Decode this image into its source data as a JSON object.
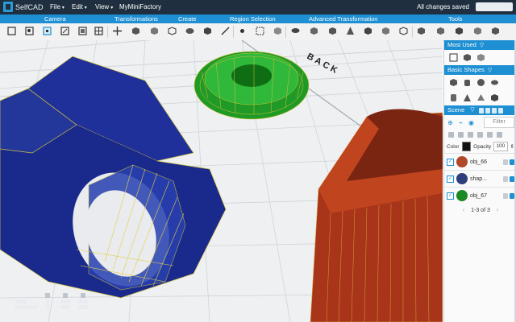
{
  "app": {
    "name": "SelfCAD",
    "project_title": "MyMiniFactory",
    "status": "All changes saved"
  },
  "menus": [
    {
      "label": "File"
    },
    {
      "label": "Edit"
    },
    {
      "label": "View"
    }
  ],
  "categories": [
    "Camera",
    "Transformations",
    "Create",
    "Region Selection",
    "Advanced Transformation",
    "Tools"
  ],
  "viewport": {
    "back_label": "BACK"
  },
  "stats": {
    "total_label": "Total",
    "selected_label": "Selected",
    "total": [
      "2",
      "493",
      "400"
    ],
    "selected": [
      "3",
      "493",
      "400"
    ]
  },
  "panel": {
    "most_used": "Most Used",
    "basic_shapes": "Basic Shapes",
    "scene": "Scene",
    "filter_placeholder": "Filter",
    "color_label": "Color",
    "opacity_label": "Opacity",
    "opacity_value": "100",
    "objects": [
      {
        "name": "obj_66",
        "thumb_color": "#b0492c"
      },
      {
        "name": "shap...",
        "thumb_color": "#2f3f7c"
      },
      {
        "name": "obj_67",
        "thumb_color": "#1a8a22"
      }
    ],
    "pager": "1-3 of 3"
  },
  "colors": {
    "accent": "#1e8fd2",
    "topbar": "#1f2f3f",
    "torus": "#22a52a",
    "nut": "#1a2a8c",
    "pacman": "#b0361a"
  }
}
